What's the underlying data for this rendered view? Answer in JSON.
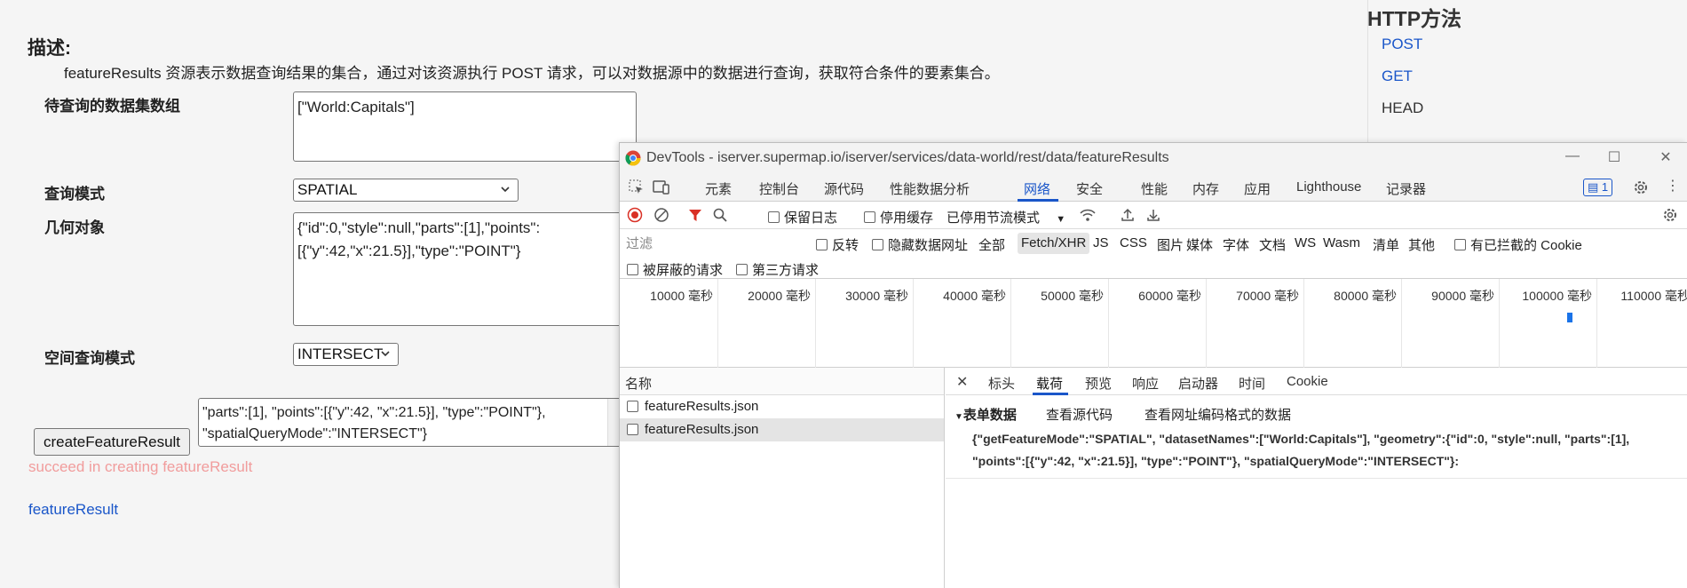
{
  "page": {
    "desc_title": "描述:",
    "desc_text": "featureResults 资源表示数据查询结果的集合，通过对该资源执行 POST 请求，可以对数据源中的数据进行查询，获取符合条件的要素集合。",
    "dataset_label": "待查询的数据集数组",
    "dataset_value": "[\"World:Capitals\"]",
    "query_mode_label": "查询模式",
    "query_mode_value": "SPATIAL",
    "geometry_label": "几何对象",
    "geometry_value": "{\"id\":0,\"style\":null,\"parts\":[1],\"points\":\n[{\"y\":42,\"x\":21.5}],\"type\":\"POINT\"}",
    "spatial_mode_label": "空间查询模式",
    "spatial_mode_value": "INTERSECT",
    "result_text": "\"parts\":[1], \"points\":[{\"y\":42, \"x\":21.5}], \"type\":\"POINT\"},\n\"spatialQueryMode\":\"INTERSECT\"}",
    "create_button": "createFeatureResult",
    "succeed_text": "succeed in creating featureResult",
    "feature_link": "featureResult"
  },
  "http": {
    "title": "HTTP方法",
    "methods": [
      "POST",
      "GET",
      "HEAD"
    ]
  },
  "devtools": {
    "title": "DevTools - iserver.supermap.io/iserver/services/data-world/rest/data/featureResults",
    "tabs": [
      "元素",
      "控制台",
      "源代码",
      "性能数据分析",
      "网络",
      "安全",
      "性能",
      "内存",
      "应用",
      "Lighthouse",
      "记录器"
    ],
    "active_tab": "网络",
    "issues_count": "1",
    "toolbar": {
      "preserve_log": "保留日志",
      "disable_cache": "停用缓存",
      "throttle": "已停用节流模式"
    },
    "filter": {
      "placeholder": "过滤",
      "invert": "反转",
      "hide_data_urls": "隐藏数据网址",
      "types": [
        "全部",
        "Fetch/XHR",
        "JS",
        "CSS",
        "图片",
        "媒体",
        "字体",
        "文档",
        "WS",
        "Wasm",
        "清单",
        "其他"
      ],
      "active_type": "Fetch/XHR",
      "blocked_cookies": "有已拦截的 Cookie",
      "blocked_requests": "被屏蔽的请求",
      "third_party": "第三方请求"
    },
    "timeline": [
      "10000 毫秒",
      "20000 毫秒",
      "30000 毫秒",
      "40000 毫秒",
      "50000 毫秒",
      "60000 毫秒",
      "70000 毫秒",
      "80000 毫秒",
      "90000 毫秒",
      "100000 毫秒",
      "110000 毫秒"
    ],
    "list": {
      "header": "名称",
      "rows": [
        "featureResults.json",
        "featureResults.json"
      ]
    },
    "detail": {
      "tabs": [
        "标头",
        "载荷",
        "预览",
        "响应",
        "启动器",
        "时间",
        "Cookie"
      ],
      "active_tab": "载荷",
      "form_data": "表单数据",
      "view_source": "查看源代码",
      "view_url_encoded": "查看网址编码格式的数据",
      "payload_line1": "{\"getFeatureMode\":\"SPATIAL\", \"datasetNames\":[\"World:Capitals\"], \"geometry\":{\"id\":0, \"style\":null, \"parts\":[1],",
      "payload_line2": "\"points\":[{\"y\":42, \"x\":21.5}], \"type\":\"POINT\"}, \"spatialQueryMode\":\"INTERSECT\"}:"
    }
  }
}
